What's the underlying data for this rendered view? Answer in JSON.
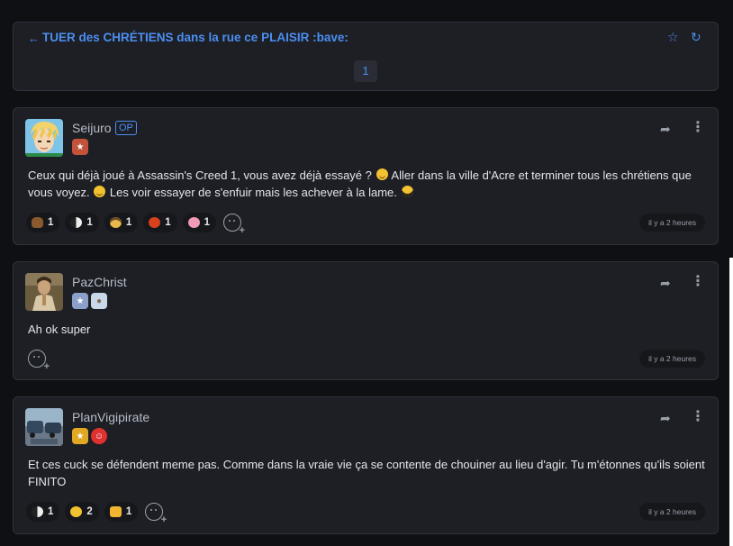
{
  "topic": {
    "back_icon": "arrow-left-icon",
    "title": "TUER des CHRÉTIENS dans la rue ce PLAISIR :bave:",
    "current_page": "1",
    "accent_color": "#4b8ef1"
  },
  "posts": [
    {
      "username": "Seijuro",
      "op_label": "OP",
      "content_parts": [
        "Ceux qui déjà joué à Assassin's Creed 1, vous avez déjà essayé ?",
        " Aller dans la ville d'Acre et terminer tous les chrétiens que vous voyez.",
        " Les voir essayer de s'enfuir mais les achever à la lame."
      ],
      "reactions": [
        {
          "icon": "poop-icon",
          "count": "1"
        },
        {
          "icon": "penguin-icon",
          "count": "1"
        },
        {
          "icon": "cowboy-icon",
          "count": "1"
        },
        {
          "icon": "angry-devil-icon",
          "count": "1"
        },
        {
          "icon": "pink-pig-icon",
          "count": "1"
        }
      ],
      "timestamp": "il y a 2 heures"
    },
    {
      "username": "PazChrist",
      "content_parts": [
        "Ah ok super"
      ],
      "reactions": [],
      "timestamp": "il y a 2 heures"
    },
    {
      "username": "PlanVigipirate",
      "content_parts": [
        "Et ces cuck se défendent meme pas. Comme dans la vraie vie ça se contente de chouiner au lieu d'agir. Tu m'étonnes qu'ils soient FINITO"
      ],
      "reactions": [
        {
          "icon": "penguin-icon",
          "count": "1"
        },
        {
          "icon": "laughing-icon",
          "count": "2"
        },
        {
          "icon": "thumbs-up-icon",
          "count": "1"
        }
      ],
      "timestamp": "il y a 2 heures"
    }
  ]
}
